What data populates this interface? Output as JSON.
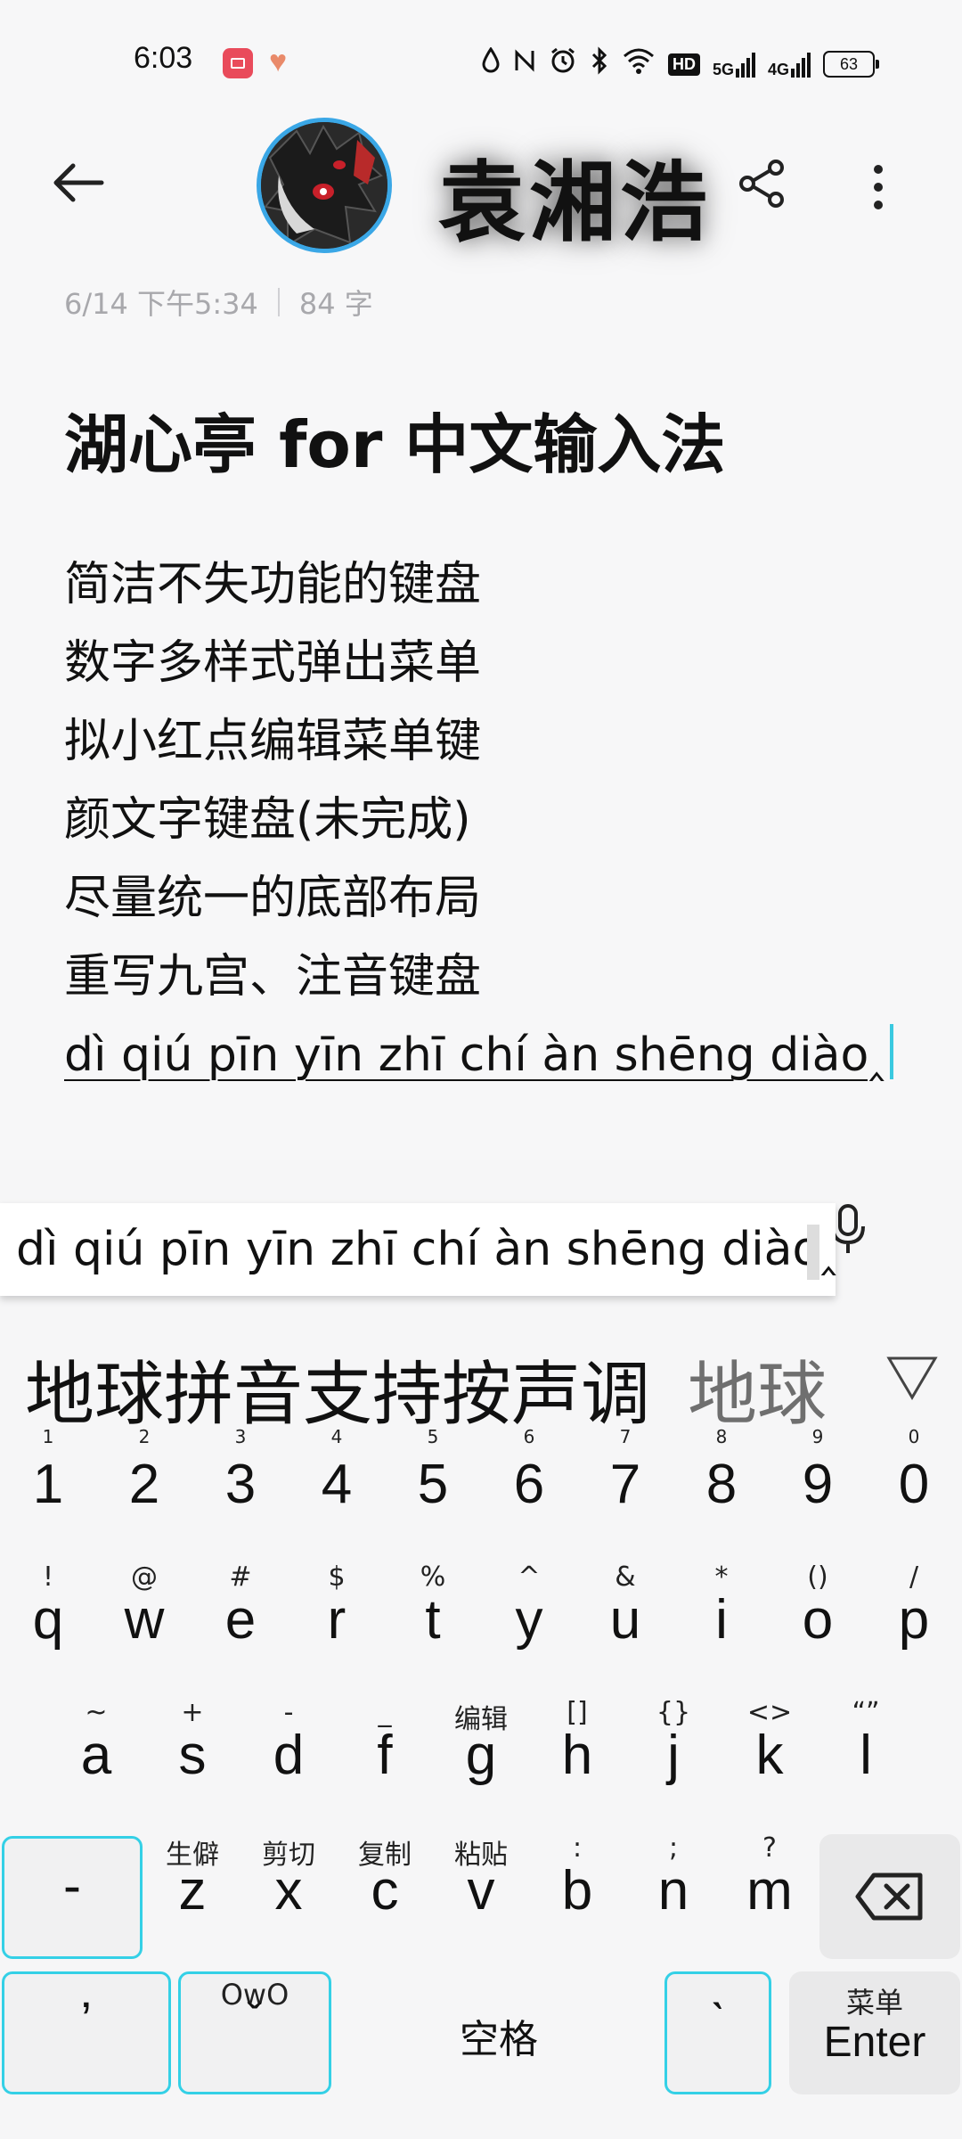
{
  "status_bar": {
    "time": "6:03",
    "icons": [
      "water-drop-icon",
      "nfc-icon",
      "alarm-icon",
      "bluetooth-icon",
      "wifi-icon"
    ],
    "hd_label": "HD",
    "net1": "5G",
    "net2": "4G",
    "battery": "63"
  },
  "header": {
    "profile_name": "袁湘浩"
  },
  "note": {
    "date": "6/14 下午5:34",
    "word_count": "84 字",
    "title": "湖心亭 for 中文输入法",
    "lines": [
      "简洁不失功能的键盘",
      "数字多样式弹出菜单",
      "拟小红点编辑菜单键",
      "颜文字键盘(未完成)",
      "尽量统一的底部布局",
      "重写九宫、注音键盘"
    ],
    "composing_line": "dì qiú pīn yīn zhī chí àn shēng diào‸"
  },
  "keyboard": {
    "preedit": "dì qiú pīn yīn zhī chí àn shēng diào‸",
    "candidate_main": "地球拼音支持按声调",
    "candidate_alt": "地球",
    "number_row": [
      {
        "hint": "1",
        "key": "1"
      },
      {
        "hint": "2",
        "key": "2"
      },
      {
        "hint": "3",
        "key": "3"
      },
      {
        "hint": "4",
        "key": "4"
      },
      {
        "hint": "5",
        "key": "5"
      },
      {
        "hint": "6",
        "key": "6"
      },
      {
        "hint": "7",
        "key": "7"
      },
      {
        "hint": "8",
        "key": "8"
      },
      {
        "hint": "9",
        "key": "9"
      },
      {
        "hint": "0",
        "key": "0"
      }
    ],
    "row1": [
      {
        "hint": "!",
        "key": "q"
      },
      {
        "hint": "@",
        "key": "w"
      },
      {
        "hint": "#",
        "key": "e"
      },
      {
        "hint": "$",
        "key": "r"
      },
      {
        "hint": "%",
        "key": "t"
      },
      {
        "hint": "^",
        "key": "y"
      },
      {
        "hint": "&",
        "key": "u"
      },
      {
        "hint": "*",
        "key": "i"
      },
      {
        "hint": "()",
        "key": "o"
      },
      {
        "hint": "/",
        "key": "p"
      }
    ],
    "row2": [
      {
        "hint": "~",
        "key": "a"
      },
      {
        "hint": "+",
        "key": "s"
      },
      {
        "hint": "-",
        "key": "d"
      },
      {
        "hint": "_",
        "key": "f"
      },
      {
        "hint": "编辑",
        "key": "g"
      },
      {
        "hint": "[]",
        "key": "h"
      },
      {
        "hint": "{}",
        "key": "j"
      },
      {
        "hint": "<>",
        "key": "k"
      },
      {
        "hint": "“”",
        "key": "l"
      }
    ],
    "row3_left": "-",
    "row3": [
      {
        "hint": "生僻",
        "key": "z"
      },
      {
        "hint": "剪切",
        "key": "x"
      },
      {
        "hint": "复制",
        "key": "c"
      },
      {
        "hint": "粘贴",
        "key": "v"
      },
      {
        "hint": ":",
        "key": "b"
      },
      {
        "hint": ";",
        "key": "n"
      },
      {
        "hint": "?",
        "key": "m"
      }
    ],
    "apostrophe_key": "ʼ",
    "emoticon_hint": "OwO",
    "emoticon_key": "ˇ",
    "space_label": "空格",
    "backtick_key": "ˋ",
    "enter_hint": "菜单",
    "enter_label": "Enter"
  },
  "colors": {
    "accent": "#34d0e6",
    "avatar_ring": "#3aa7e6",
    "meta_text": "#a8a8ac"
  }
}
